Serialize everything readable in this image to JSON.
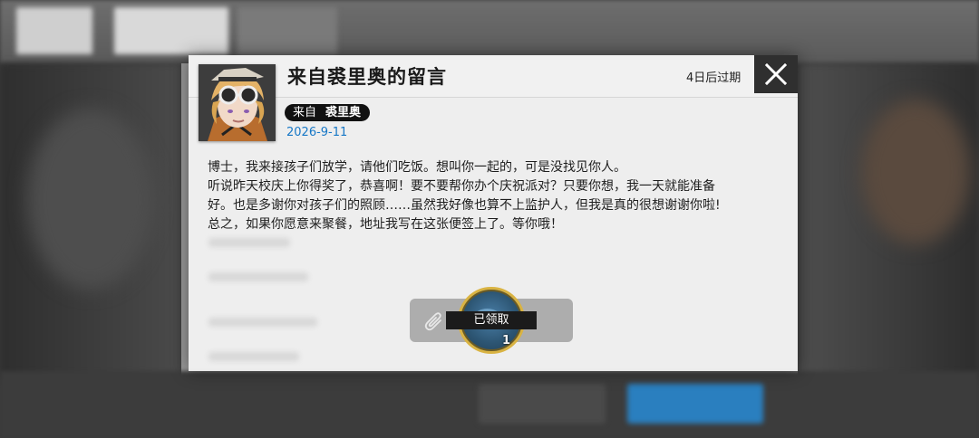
{
  "mail": {
    "title": "来自裘里奥的留言",
    "expire": "4日后过期",
    "sender_prefix": "来自",
    "sender_name": "裘里奥",
    "date": "2026-9-11",
    "body": [
      "博士，我来接孩子们放学，请他们吃饭。想叫你一起的，可是没找见你人。",
      "听说昨天校庆上你得奖了，恭喜啊！要不要帮你办个庆祝派对？只要你想，我一天就能准备",
      "好。也是多谢你对孩子们的照顾……虽然我好像也算不上监护人，但我是真的很想谢谢你啦!",
      "总之，如果你愿意来聚餐，地址我写在这张便签上了。等你哦！"
    ]
  },
  "attachment": {
    "status": "已领取",
    "count": "1",
    "icon": "paperclip-icon"
  },
  "colors": {
    "date": "#1677c6",
    "item_border": "#d9b342",
    "close_bg": "#2f2f2f"
  }
}
